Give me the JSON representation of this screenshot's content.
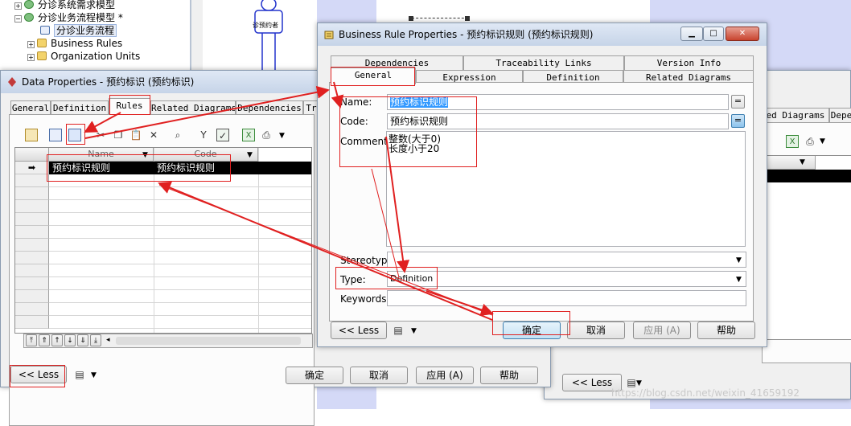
{
  "model_tree": {
    "items": [
      {
        "label": "分诊系统需求模型"
      },
      {
        "label": "分诊业务流程模型 *"
      },
      {
        "label": "分诊业务流程"
      },
      {
        "label": "Business Rules"
      },
      {
        "label": "Organization Units"
      }
    ]
  },
  "diagram": {
    "actor_label": "诊预约者"
  },
  "data_properties": {
    "title": "Data Properties - 预约标识 (预约标识)",
    "tabs": [
      {
        "label": "General"
      },
      {
        "label": "Definition"
      },
      {
        "label": "Rules"
      },
      {
        "label": "Related Diagrams"
      },
      {
        "label": "Dependencies"
      },
      {
        "label": "Tr"
      }
    ],
    "active_tab": "Rules",
    "grid": {
      "columns": [
        {
          "label": "Name"
        },
        {
          "label": "Code"
        }
      ],
      "rows": [
        {
          "name": "预约标识规则",
          "code": "预约标识规则"
        }
      ],
      "row_indicator": "➡"
    },
    "less_button": "<< Less",
    "buttons": {
      "ok": "确定",
      "cancel": "取消",
      "apply": "应用 (A)",
      "help": "帮助"
    }
  },
  "right_window": {
    "tabs": [
      {
        "label": "ed Diagrams"
      },
      {
        "label": "Depe"
      }
    ],
    "less_button": "<< Less"
  },
  "business_rule": {
    "title": "Business Rule Properties - 预约标识规则 (预约标识规则)",
    "tabs_row1": [
      {
        "label": "Dependencies"
      },
      {
        "label": "Traceability Links"
      },
      {
        "label": "Version Info"
      }
    ],
    "tabs_row2": [
      {
        "label": "General"
      },
      {
        "label": "Expression"
      },
      {
        "label": "Definition"
      },
      {
        "label": "Related Diagrams"
      }
    ],
    "active_tab": "General",
    "fields": {
      "name_label": "Name:",
      "name_value": "预约标识规则",
      "code_label": "Code:",
      "code_value": "预约标识规则",
      "comment_label": "Comment:",
      "comment_lines": [
        "整数(大于0)",
        "长度小于20"
      ],
      "stereotype_label": "Stereotype:",
      "stereotype_value": "",
      "type_label": "Type:",
      "type_value": "Definition",
      "keywords_label": "Keywords:",
      "keywords_value": ""
    },
    "equal_button": "=",
    "less_button": "<< Less",
    "buttons": {
      "ok": "确定",
      "cancel": "取消",
      "apply": "应用 (A)",
      "help": "帮助"
    }
  },
  "watermark": "https://blog.csdn.net/weixin_41659192",
  "colors": {
    "annotation_red": "#e02020",
    "selection_black": "#000000",
    "canvas_lavender": "#d4d9f7"
  }
}
